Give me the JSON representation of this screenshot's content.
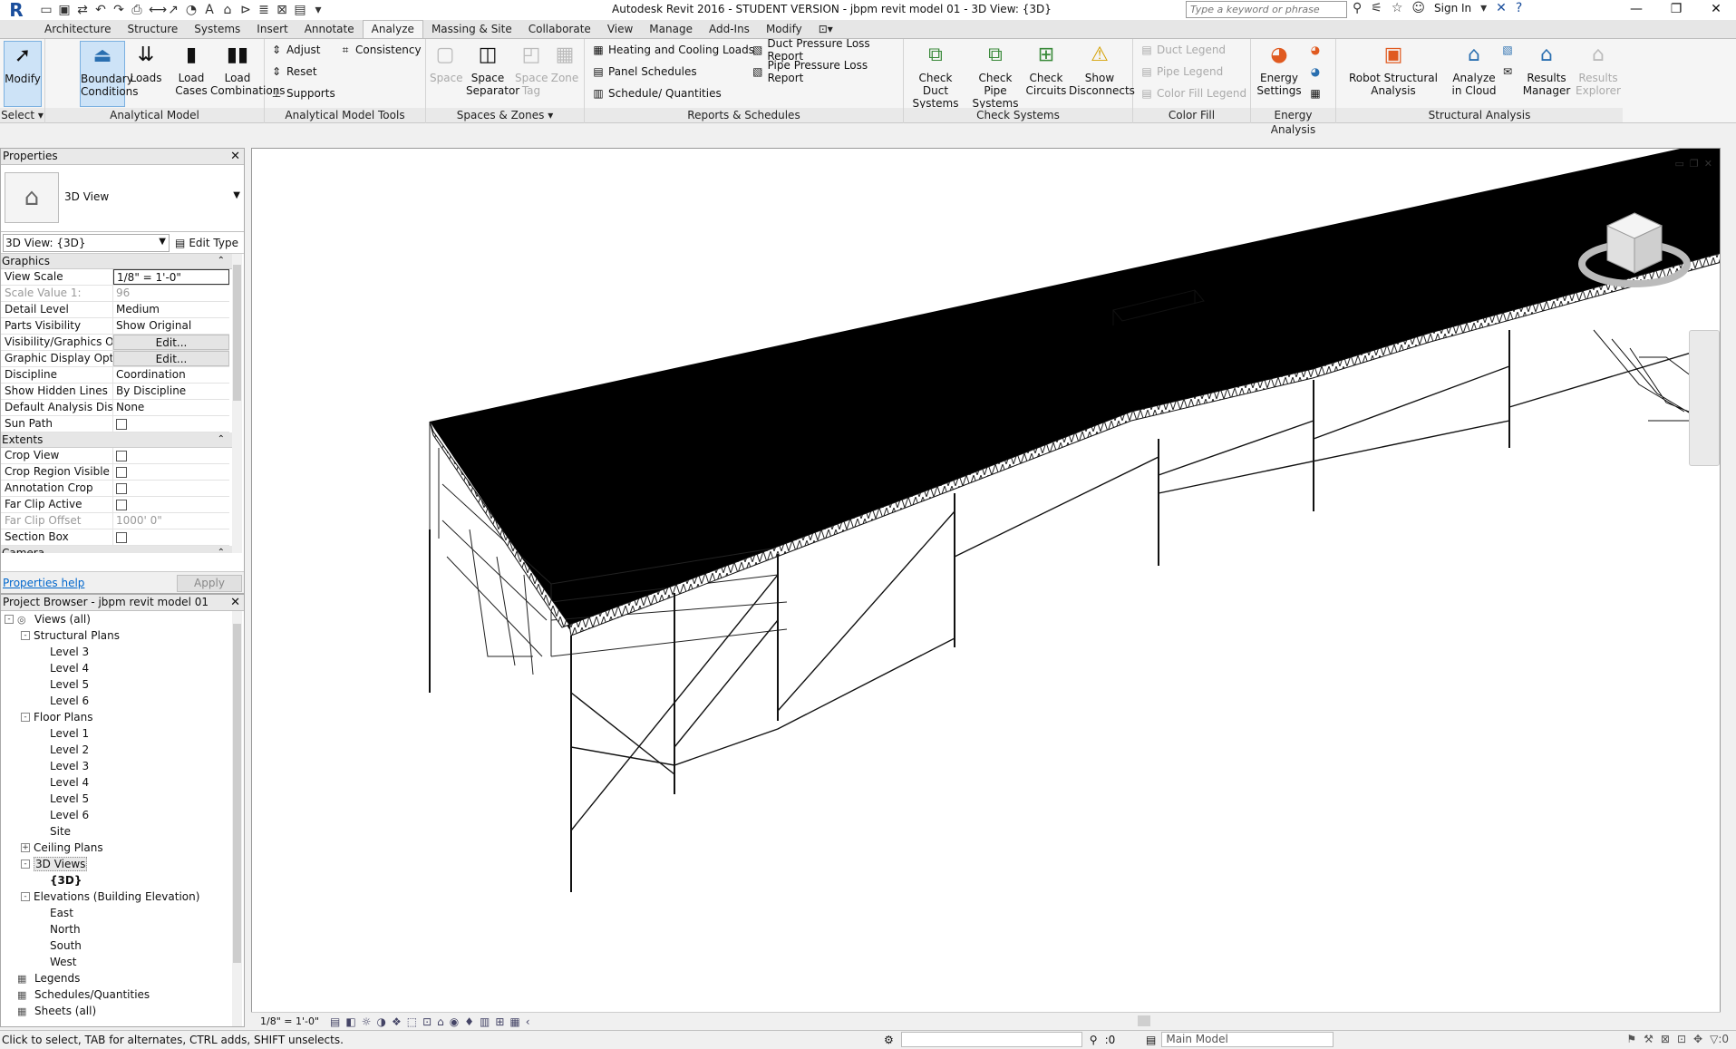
{
  "titlebar": {
    "window_title": "Autodesk Revit 2016 - STUDENT VERSION -      jbpm revit model 01 - 3D View: {3D}",
    "search_placeholder": "Type a keyword or phrase",
    "sign_in": "Sign In"
  },
  "tabs": [
    "Architecture",
    "Structure",
    "Systems",
    "Insert",
    "Annotate",
    "Analyze",
    "Massing & Site",
    "Collaborate",
    "View",
    "Manage",
    "Add-Ins",
    "Modify"
  ],
  "active_tab": "Analyze",
  "ribbon": {
    "select": {
      "modify": "Modify",
      "panel": "Select"
    },
    "analytical_model": {
      "boundary": "Boundary Conditions",
      "loads": "Loads",
      "load_cases": "Load Cases",
      "load_combinations": "Load Combinations",
      "panel": "Analytical Model"
    },
    "analytical_tools": {
      "adjust": "Adjust",
      "reset": "Reset",
      "supports": "Supports",
      "consistency": "Consistency",
      "panel": "Analytical Model Tools"
    },
    "spaces": {
      "space": "Space",
      "separator": "Space Separator",
      "tag": "Space Tag",
      "zone": "Zone",
      "panel": "Spaces & Zones"
    },
    "reports": {
      "heating": "Heating and  Cooling Loads",
      "panel_sched": "Panel  Schedules",
      "schedule": "Schedule/  Quantities",
      "duct_loss": "Duct Pressure  Loss Report",
      "pipe_loss": "Pipe Pressure  Loss Report",
      "panel": "Reports & Schedules"
    },
    "check": {
      "duct": "Check Duct Systems",
      "pipe": "Check Pipe Systems",
      "circuits": "Check Circuits",
      "disconnects": "Show Disconnects",
      "panel": "Check Systems"
    },
    "color_fill": {
      "duct_legend": "Duct  Legend",
      "pipe_legend": "Pipe  Legend",
      "cf_legend": "Color Fill  Legend",
      "panel": "Color Fill"
    },
    "energy": {
      "settings": "Energy Settings",
      "panel": "Energy Analysis"
    },
    "structural": {
      "robot": "Robot Structural Analysis",
      "cloud": "Analyze in Cloud",
      "results_mgr": "Results Manager",
      "results_exp": "Results Explorer",
      "panel": "Structural Analysis"
    }
  },
  "properties": {
    "title": "Properties",
    "type_name": "3D View",
    "instance": "3D View: {3D}",
    "edit_type": "Edit Type",
    "groups": [
      {
        "name": "Graphics",
        "rows": [
          {
            "k": "View Scale",
            "v": "1/8\" = 1'-0\"",
            "style": "inp"
          },
          {
            "k": "Scale Value    1:",
            "v": "96",
            "style": "grey"
          },
          {
            "k": "Detail Level",
            "v": "Medium"
          },
          {
            "k": "Parts Visibility",
            "v": "Show Original"
          },
          {
            "k": "Visibility/Graphics O...",
            "v": "Edit...",
            "style": "btn"
          },
          {
            "k": "Graphic Display Opti...",
            "v": "Edit...",
            "style": "btn"
          },
          {
            "k": "Discipline",
            "v": "Coordination"
          },
          {
            "k": "Show Hidden Lines",
            "v": "By Discipline"
          },
          {
            "k": "Default Analysis Dis...",
            "v": "None"
          },
          {
            "k": "Sun Path",
            "v": "",
            "style": "chk"
          }
        ]
      },
      {
        "name": "Extents",
        "rows": [
          {
            "k": "Crop View",
            "v": "",
            "style": "chk"
          },
          {
            "k": "Crop Region Visible",
            "v": "",
            "style": "chk"
          },
          {
            "k": "Annotation Crop",
            "v": "",
            "style": "chk"
          },
          {
            "k": "Far Clip Active",
            "v": "",
            "style": "chk"
          },
          {
            "k": "Far Clip Offset",
            "v": "1000'  0\"",
            "style": "grey"
          },
          {
            "k": "Section Box",
            "v": "",
            "style": "chk"
          }
        ]
      },
      {
        "name": "Camera",
        "rows": []
      }
    ],
    "help": "Properties help",
    "apply": "Apply"
  },
  "browser": {
    "title": "Project Browser - jbpm revit model 01",
    "nodes": [
      {
        "label": "Views (all)",
        "level": 0,
        "toggle": "-",
        "icon": "views"
      },
      {
        "label": "Structural Plans",
        "level": 1,
        "toggle": "-"
      },
      {
        "label": "Level 3",
        "level": 2
      },
      {
        "label": "Level 4",
        "level": 2
      },
      {
        "label": "Level 5",
        "level": 2
      },
      {
        "label": "Level 6",
        "level": 2
      },
      {
        "label": "Floor Plans",
        "level": 1,
        "toggle": "-"
      },
      {
        "label": "Level 1",
        "level": 2
      },
      {
        "label": "Level 2",
        "level": 2
      },
      {
        "label": "Level 3",
        "level": 2
      },
      {
        "label": "Level 4",
        "level": 2
      },
      {
        "label": "Level 5",
        "level": 2
      },
      {
        "label": "Level 6",
        "level": 2
      },
      {
        "label": "Site",
        "level": 2
      },
      {
        "label": "Ceiling Plans",
        "level": 1,
        "toggle": "+"
      },
      {
        "label": "3D Views",
        "level": 1,
        "toggle": "-",
        "selected": true
      },
      {
        "label": "{3D}",
        "level": 2,
        "bold": true
      },
      {
        "label": "Elevations (Building Elevation)",
        "level": 1,
        "toggle": "-"
      },
      {
        "label": "East",
        "level": 2
      },
      {
        "label": "North",
        "level": 2
      },
      {
        "label": "South",
        "level": 2
      },
      {
        "label": "West",
        "level": 2
      },
      {
        "label": "Legends",
        "level": 0,
        "icon": "sheet"
      },
      {
        "label": "Schedules/Quantities",
        "level": 0,
        "icon": "sheet"
      },
      {
        "label": "Sheets (all)",
        "level": 0,
        "icon": "sheet"
      }
    ]
  },
  "viewbar": {
    "scale": "1/8\" = 1'-0\""
  },
  "status": {
    "text": "Click to select, TAB for alternates, CTRL adds, SHIFT unselects.",
    "zero": ":0",
    "model": "Main Model"
  }
}
